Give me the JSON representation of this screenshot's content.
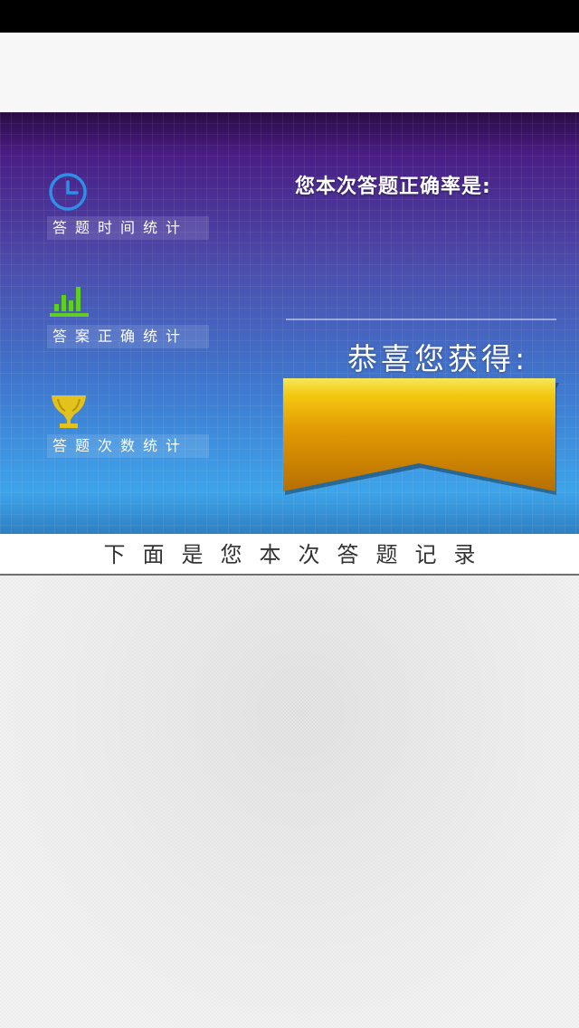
{
  "stats": {
    "items": [
      {
        "label": "答题时间统计",
        "icon": "clock-icon",
        "color": "#2f8ee8"
      },
      {
        "label": "答案正确统计",
        "icon": "bar-chart-icon",
        "color": "#5fd01e"
      },
      {
        "label": "答题次数统计",
        "icon": "trophy-icon",
        "color": "#e3c21e"
      }
    ]
  },
  "result": {
    "accuracy_heading": "您本次答题正确率是:",
    "congrats_text": "恭喜您获得:",
    "ribbon_color": "#e2a300"
  },
  "records": {
    "header": "下面是您本次答题记录"
  }
}
